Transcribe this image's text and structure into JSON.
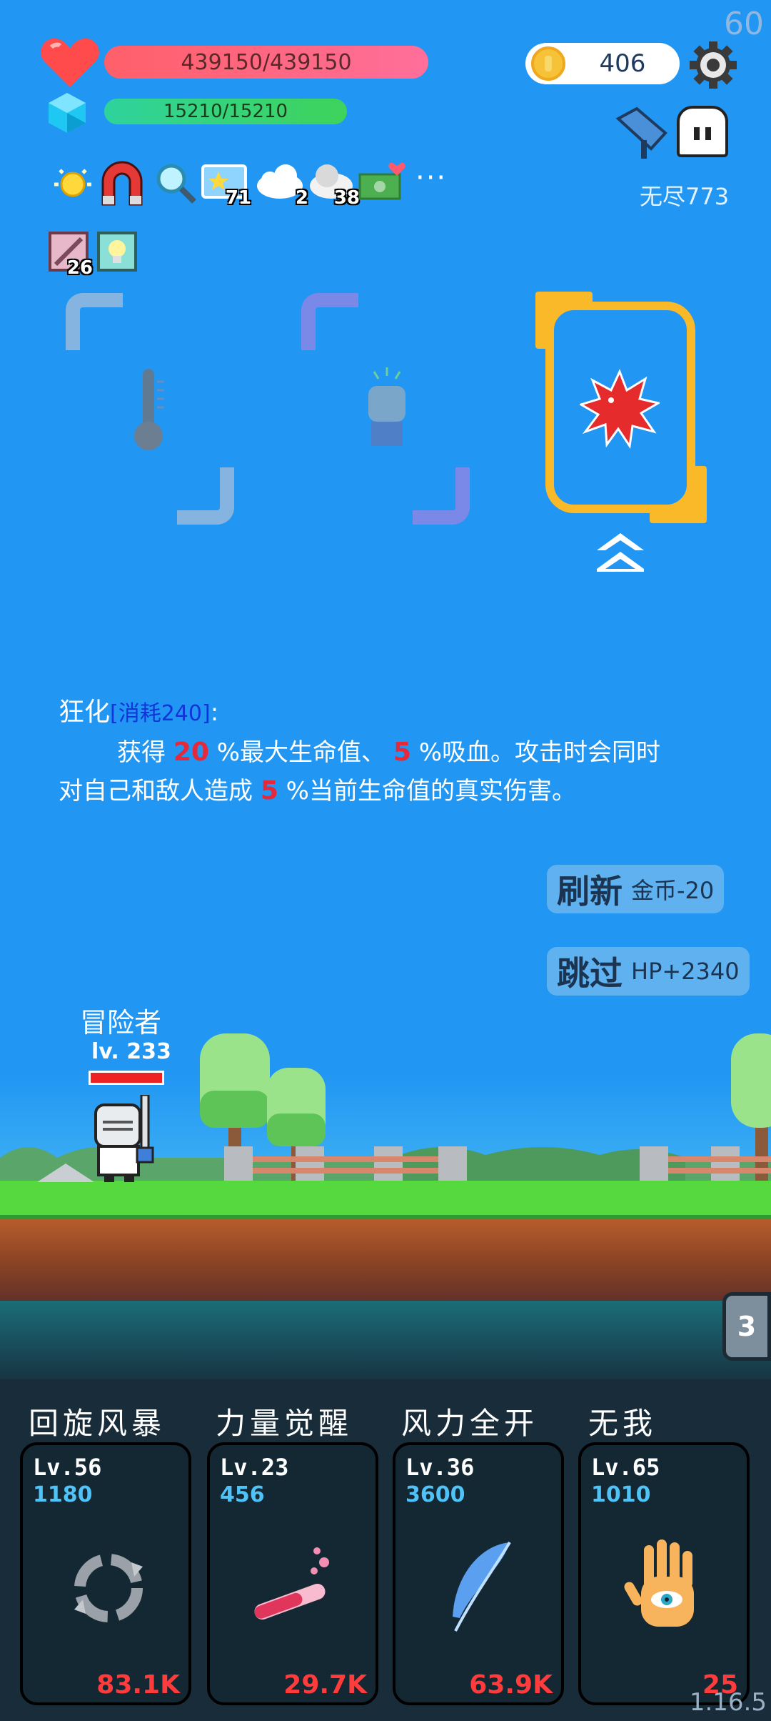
{
  "fps": "60",
  "version": "1.16.5",
  "hp": {
    "text": "439150/439150"
  },
  "mp": {
    "text": "15210/15210"
  },
  "coins": "406",
  "endless": "无尽773",
  "buffs": [
    {
      "icon": "sun-icon",
      "count": ""
    },
    {
      "icon": "magnet-icon",
      "count": ""
    },
    {
      "icon": "magnifier-icon",
      "count": ""
    },
    {
      "icon": "star-card-icon",
      "count": "71"
    },
    {
      "icon": "cloud-icon",
      "count": "2"
    },
    {
      "icon": "gray-cloud-icon",
      "count": "38"
    },
    {
      "icon": "money-heart-icon",
      "count": ""
    },
    {
      "icon": "sword-scroll-icon",
      "count": "26"
    },
    {
      "icon": "lightbulb-icon",
      "count": ""
    }
  ],
  "more": "···",
  "cards": [
    {
      "icon": "thermometer-icon"
    },
    {
      "icon": "fist-icon"
    },
    {
      "icon": "blood-splash-icon",
      "selected": true
    }
  ],
  "description": {
    "title": "狂化",
    "cost": "[消耗240]",
    "colon": ":",
    "part1": "获得 ",
    "val1": "20",
    "part2": " %最大生命值、 ",
    "val2": "5",
    "part3": " %吸血。攻击时会同时",
    "part4": "对自己和敌人造成 ",
    "val3": "5",
    "part5": " %当前生命值的真实伤害。"
  },
  "buttons": {
    "refresh_main": "刷新",
    "refresh_sub": "金币-20",
    "skip_main": "跳过",
    "skip_sub": "HP+2340"
  },
  "player": {
    "name": "冒险者",
    "level": "lv. 233"
  },
  "wave": "3",
  "skills": [
    {
      "name": "回旋风暴",
      "level": "Lv.56",
      "value": "1180",
      "cost": "83.1K",
      "icon": "whirlwind-icon"
    },
    {
      "name": "力量觉醒",
      "level": "Lv.23",
      "value": "456",
      "cost": "29.7K",
      "icon": "potion-tube-icon"
    },
    {
      "name": "风力全开",
      "level": "Lv.36",
      "value": "3600",
      "cost": "63.9K",
      "icon": "feather-icon"
    },
    {
      "name": "无我",
      "level": "Lv.65",
      "value": "1010",
      "cost": "25",
      "icon": "eye-hand-icon"
    }
  ],
  "colors": {
    "background": "#2196F3",
    "hp": "#ff5f69",
    "mp": "#3fd35a",
    "accent_red": "#e5283a",
    "card_selected": "#f9b928"
  }
}
